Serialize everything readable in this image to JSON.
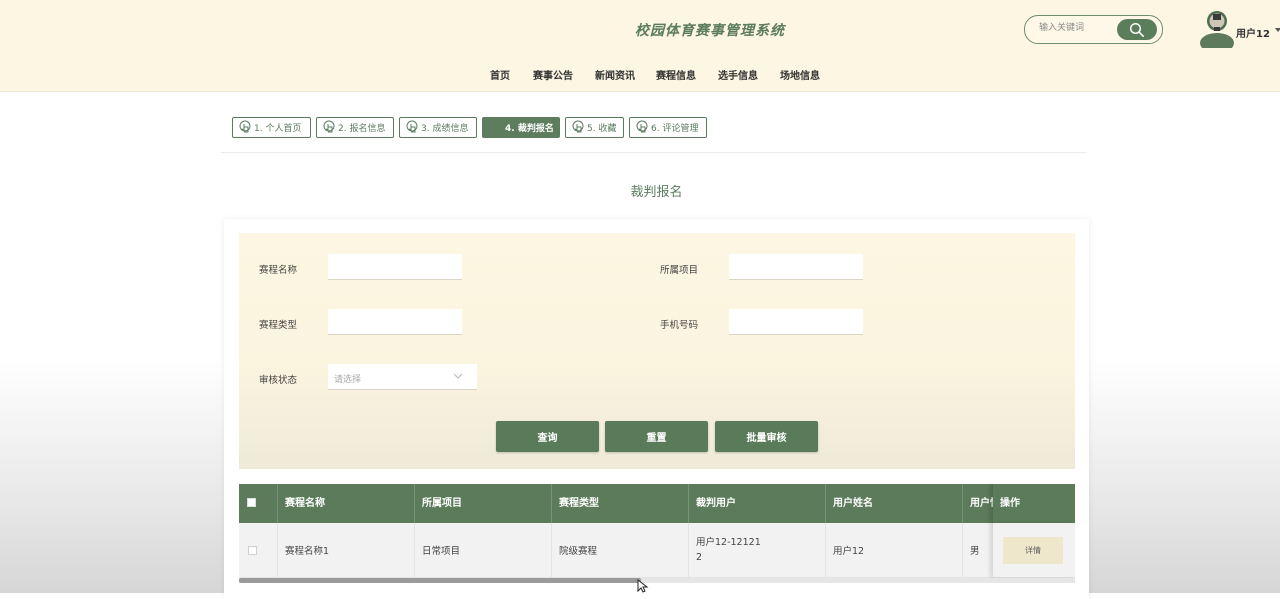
{
  "header": {
    "site_title": "校园体育赛事管理系统",
    "search_placeholder": "输入关键词",
    "user_name": "用户12",
    "nav": [
      "首页",
      "赛事公告",
      "新闻资讯",
      "赛程信息",
      "选手信息",
      "场地信息"
    ]
  },
  "tabs": [
    {
      "label": "1. 个人首页",
      "active": false
    },
    {
      "label": "2. 报名信息",
      "active": false
    },
    {
      "label": "3. 成绩信息",
      "active": false
    },
    {
      "label": "4. 裁判报名",
      "active": true
    },
    {
      "label": "5. 收藏",
      "active": false
    },
    {
      "label": "6. 评论管理",
      "active": false
    }
  ],
  "page_title": "裁判报名",
  "form": {
    "event_name_label": "赛程名称",
    "project_label": "所属项目",
    "event_type_label": "赛程类型",
    "phone_label": "手机号码",
    "status_label": "审核状态",
    "status_placeholder": "请选择",
    "query_button": "查询",
    "reset_button": "重置",
    "batch_review_button": "批量审核"
  },
  "table": {
    "columns": [
      "赛程名称",
      "所属项目",
      "赛程类型",
      "裁判用户",
      "用户姓名",
      "用户性别",
      "操作"
    ],
    "rows": [
      {
        "event_name": "赛程名称1",
        "project": "日常项目",
        "event_type": "院级赛程",
        "referee_user_line1": "用户12-12121",
        "referee_user_line2": "2",
        "user_name": "用户12",
        "gender": "男",
        "detail_button": "详情"
      }
    ]
  },
  "colors": {
    "accent": "#5b7b5b",
    "header_bg": "#fcf6e3",
    "form_bg": "#fbf4df"
  }
}
